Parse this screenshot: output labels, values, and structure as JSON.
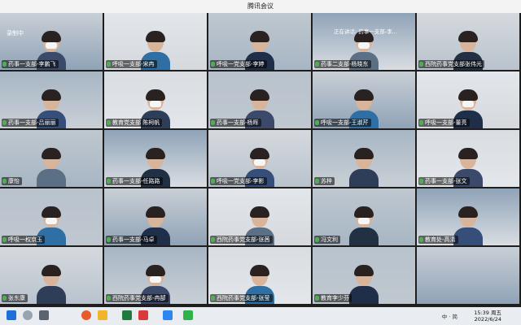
{
  "window": {
    "title": "腾讯会议"
  },
  "overlays": {
    "recording": "录制中",
    "speaking": "正在讲话: 药事一支部-李..."
  },
  "tiles": [
    {
      "label": "药事一支部-李鹏飞"
    },
    {
      "label": "呼吸一支部-宋冉"
    },
    {
      "label": "呼吸一党支部-李婷"
    },
    {
      "label": "药事二支部-杨晓东"
    },
    {
      "label": "西院药事党支部张伟光"
    },
    {
      "label": "药事一支部-吕丽丽"
    },
    {
      "label": "教育党支部 陈柯帆"
    },
    {
      "label": "药事一支部-杨晖"
    },
    {
      "label": "呼吸一支部-王淑芹"
    },
    {
      "label": "呼吸一支部-董亮"
    },
    {
      "label": "康怡"
    },
    {
      "label": "药事一支部-任路路"
    },
    {
      "label": "呼吸一党支部-李影"
    },
    {
      "label": "苏梓"
    },
    {
      "label": "药事一支部-张文"
    },
    {
      "label": "呼吸一权京玉"
    },
    {
      "label": "药事一支部-马卓"
    },
    {
      "label": "西院药事党支部-张茜"
    },
    {
      "label": "冯文利"
    },
    {
      "label": "教育处-高清"
    },
    {
      "label": "张东康"
    },
    {
      "label": "西院药事党支部-冉郜"
    },
    {
      "label": "西院药事党支部-张莹"
    },
    {
      "label": "教育李少芬"
    },
    {
      "label": ""
    }
  ],
  "taskbar": {
    "tray_text": "中 · 简",
    "time": "15:39 周五",
    "date": "2022/6/24"
  },
  "chart_data": {
    "type": "table",
    "categories": [],
    "values": []
  }
}
